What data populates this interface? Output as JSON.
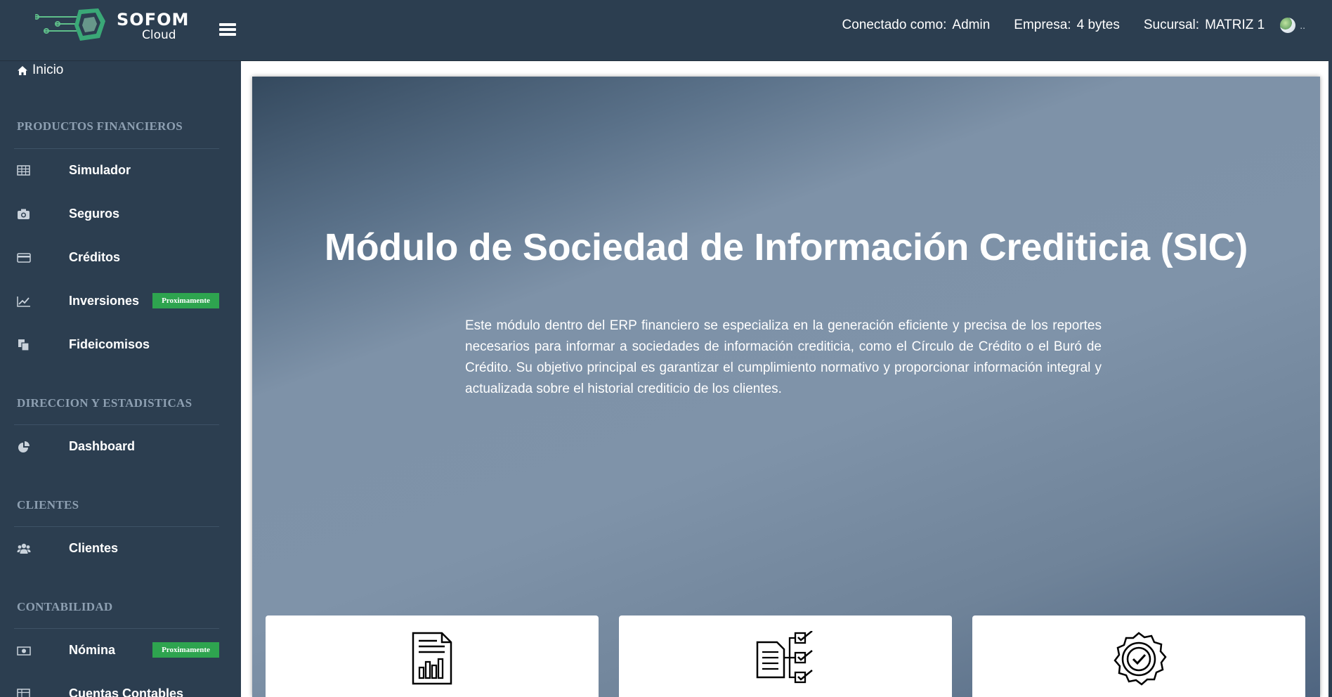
{
  "brand": {
    "name": "SOFOM",
    "sub": "Cloud"
  },
  "header": {
    "connected_label": "Conectado como:",
    "connected_value": "Admin",
    "company_label": "Empresa:",
    "company_value": "4 bytes",
    "branch_label": "Sucursal:",
    "branch_value": "MATRIZ 1",
    "dots": ".."
  },
  "sidebar": {
    "home": "Inicio",
    "sections": [
      {
        "title": "PRODUCTOS FINANCIEROS"
      },
      {
        "title": "DIRECCION Y ESTADISTICAS"
      },
      {
        "title": "CLIENTES"
      },
      {
        "title": "CONTABILIDAD"
      }
    ],
    "items": [
      {
        "label": "Simulador",
        "icon": "table-icon"
      },
      {
        "label": "Seguros",
        "icon": "camera-icon"
      },
      {
        "label": "Créditos",
        "icon": "credit-card-icon"
      },
      {
        "label": "Inversiones",
        "icon": "line-chart-icon",
        "badge": "Proximamente"
      },
      {
        "label": "Fideicomisos",
        "icon": "copy-icon"
      },
      {
        "label": "Dashboard",
        "icon": "pie-chart-icon"
      },
      {
        "label": "Clientes",
        "icon": "users-icon"
      },
      {
        "label": "Nómina",
        "icon": "money-icon",
        "badge": "Proximamente"
      },
      {
        "label": "Cuentas Contables",
        "icon": "table-icon"
      }
    ]
  },
  "main": {
    "title": "Módulo de Sociedad de Información Crediticia (SIC)",
    "description": "Este módulo dentro del ERP financiero se especializa en la generación eficiente y precisa de los reportes necesarios para informar a sociedades de información crediticia, como el Círculo de Crédito o el Buró de Crédito. Su objetivo principal es garantizar el cumplimiento normativo y proporcionar información integral y actualizada sobre el historial crediticio de los clientes.",
    "cards": [
      {
        "icon": "report-document-icon"
      },
      {
        "icon": "checklist-icon"
      },
      {
        "icon": "verified-badge-icon"
      }
    ]
  },
  "colors": {
    "sidebar_bg": "#2c3e50",
    "badge_green": "#2ea44f",
    "section_title": "#8ea0b2"
  }
}
